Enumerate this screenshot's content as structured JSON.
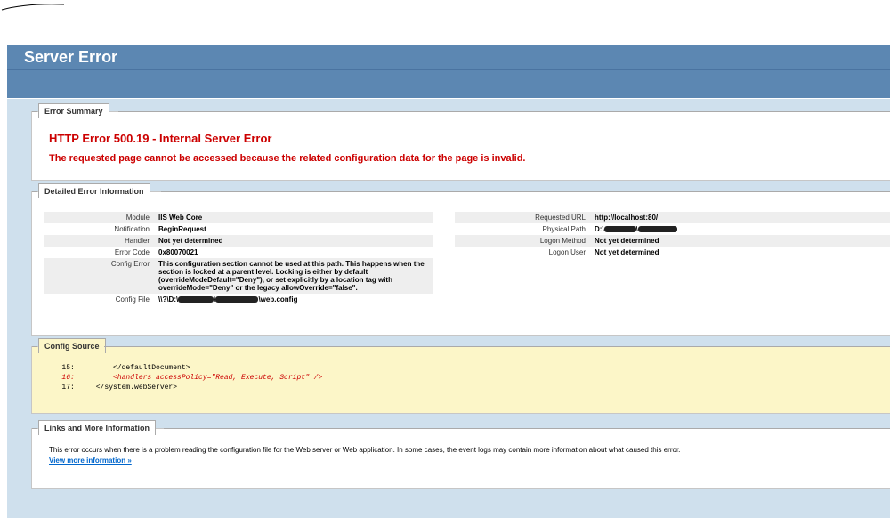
{
  "header": {
    "title": "Server Error"
  },
  "summary": {
    "legend": "Error Summary",
    "title": "HTTP Error 500.19 - Internal Server Error",
    "message": "The requested page cannot be accessed because the related configuration data for the page is invalid."
  },
  "details": {
    "legend": "Detailed Error Information",
    "left": {
      "module": {
        "label": "Module",
        "value": "IIS Web Core"
      },
      "notification": {
        "label": "Notification",
        "value": "BeginRequest"
      },
      "handler": {
        "label": "Handler",
        "value": "Not yet determined"
      },
      "error_code": {
        "label": "Error Code",
        "value": "0x80070021"
      },
      "config_error": {
        "label": "Config Error",
        "value": "This configuration section cannot be used at this path. This happens when the section is locked at a parent level. Locking is either by default (overrideModeDefault=\"Deny\"), or set explicitly by a location tag with overrideMode=\"Deny\" or the legacy allowOverride=\"false\"."
      },
      "config_file": {
        "label": "Config File",
        "prefix": "\\\\?\\D:\\",
        "sep": "\\",
        "suffix": "\\web.config"
      }
    },
    "right": {
      "requested_url": {
        "label": "Requested URL",
        "value": "http://localhost:80/"
      },
      "physical_path": {
        "label": "Physical Path",
        "prefix": "D:\\",
        "sep": "\\"
      },
      "logon_method": {
        "label": "Logon Method",
        "value": "Not yet determined"
      },
      "logon_user": {
        "label": "Logon User",
        "value": "Not yet determined"
      }
    }
  },
  "config_source": {
    "legend": "Config Source",
    "lines": [
      {
        "text": "   15:         </defaultDocument>",
        "highlight": false
      },
      {
        "text": "   16:         <handlers accessPolicy=\"Read, Execute, Script\" />",
        "highlight": true
      },
      {
        "text": "   17:     </system.webServer>",
        "highlight": false
      }
    ]
  },
  "links": {
    "legend": "Links and More Information",
    "text": "This error occurs when there is a problem reading the configuration file for the Web server or Web application. In some cases, the event logs may contain more information about what caused this error.",
    "more": "View more information »"
  },
  "colors": {
    "header": "#5c87b2",
    "content_bg": "#cfe0ed",
    "error_red": "#cc0000",
    "source_bg": "#fcf6c8",
    "link": "#0066cc"
  }
}
